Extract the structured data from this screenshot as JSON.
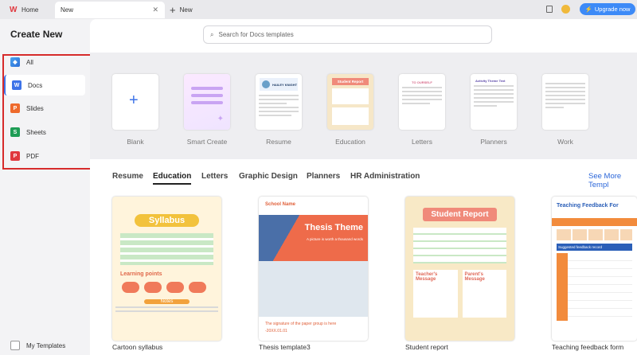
{
  "tabs": {
    "home": "Home",
    "new": "New",
    "new_tab": "New"
  },
  "upgrade": "Upgrade now",
  "sidebar": {
    "title": "Create New",
    "items": [
      {
        "label": "All"
      },
      {
        "label": "Docs"
      },
      {
        "label": "Slides"
      },
      {
        "label": "Sheets"
      },
      {
        "label": "PDF"
      }
    ],
    "my_templates": "My Templates"
  },
  "search": {
    "placeholder": "Search for Docs templates"
  },
  "quick": [
    {
      "label": "Blank"
    },
    {
      "label": "Smart Create"
    },
    {
      "label": "Resume"
    },
    {
      "label": "Education"
    },
    {
      "label": "Letters"
    },
    {
      "label": "Planners"
    },
    {
      "label": "Work"
    }
  ],
  "quick_art": {
    "resume_name": "HAILEY KNIGHT",
    "education_title": "Student Report",
    "letters_title": "TO OURSELF",
    "planners_title": "Activity Theme Text"
  },
  "categories": [
    "Resume",
    "Education",
    "Letters",
    "Graphic Design",
    "Planners",
    "HR Administration"
  ],
  "see_more": "See More Templ",
  "templates": [
    {
      "name": "Cartoon syllabus",
      "title": "Syllabus",
      "sub1": "Learning points",
      "sub2": "Notes"
    },
    {
      "name": "Thesis template3",
      "school": "School Name",
      "title": "Thesis Theme",
      "subtitle": "A picture is worth a thousand words",
      "footer": "The signature of the paper group is here",
      "date": "-20XX.01.01"
    },
    {
      "name": "Student report",
      "title": "Student Report",
      "msg1": "Teacher's Message",
      "msg2": "Parent's Message"
    },
    {
      "name": "Teaching feedback form",
      "title": "Teaching Feedback For",
      "sub": "Suggested feedback record"
    }
  ],
  "colors": {
    "accent": "#3d8af7",
    "highlight": "#d62b2b"
  }
}
